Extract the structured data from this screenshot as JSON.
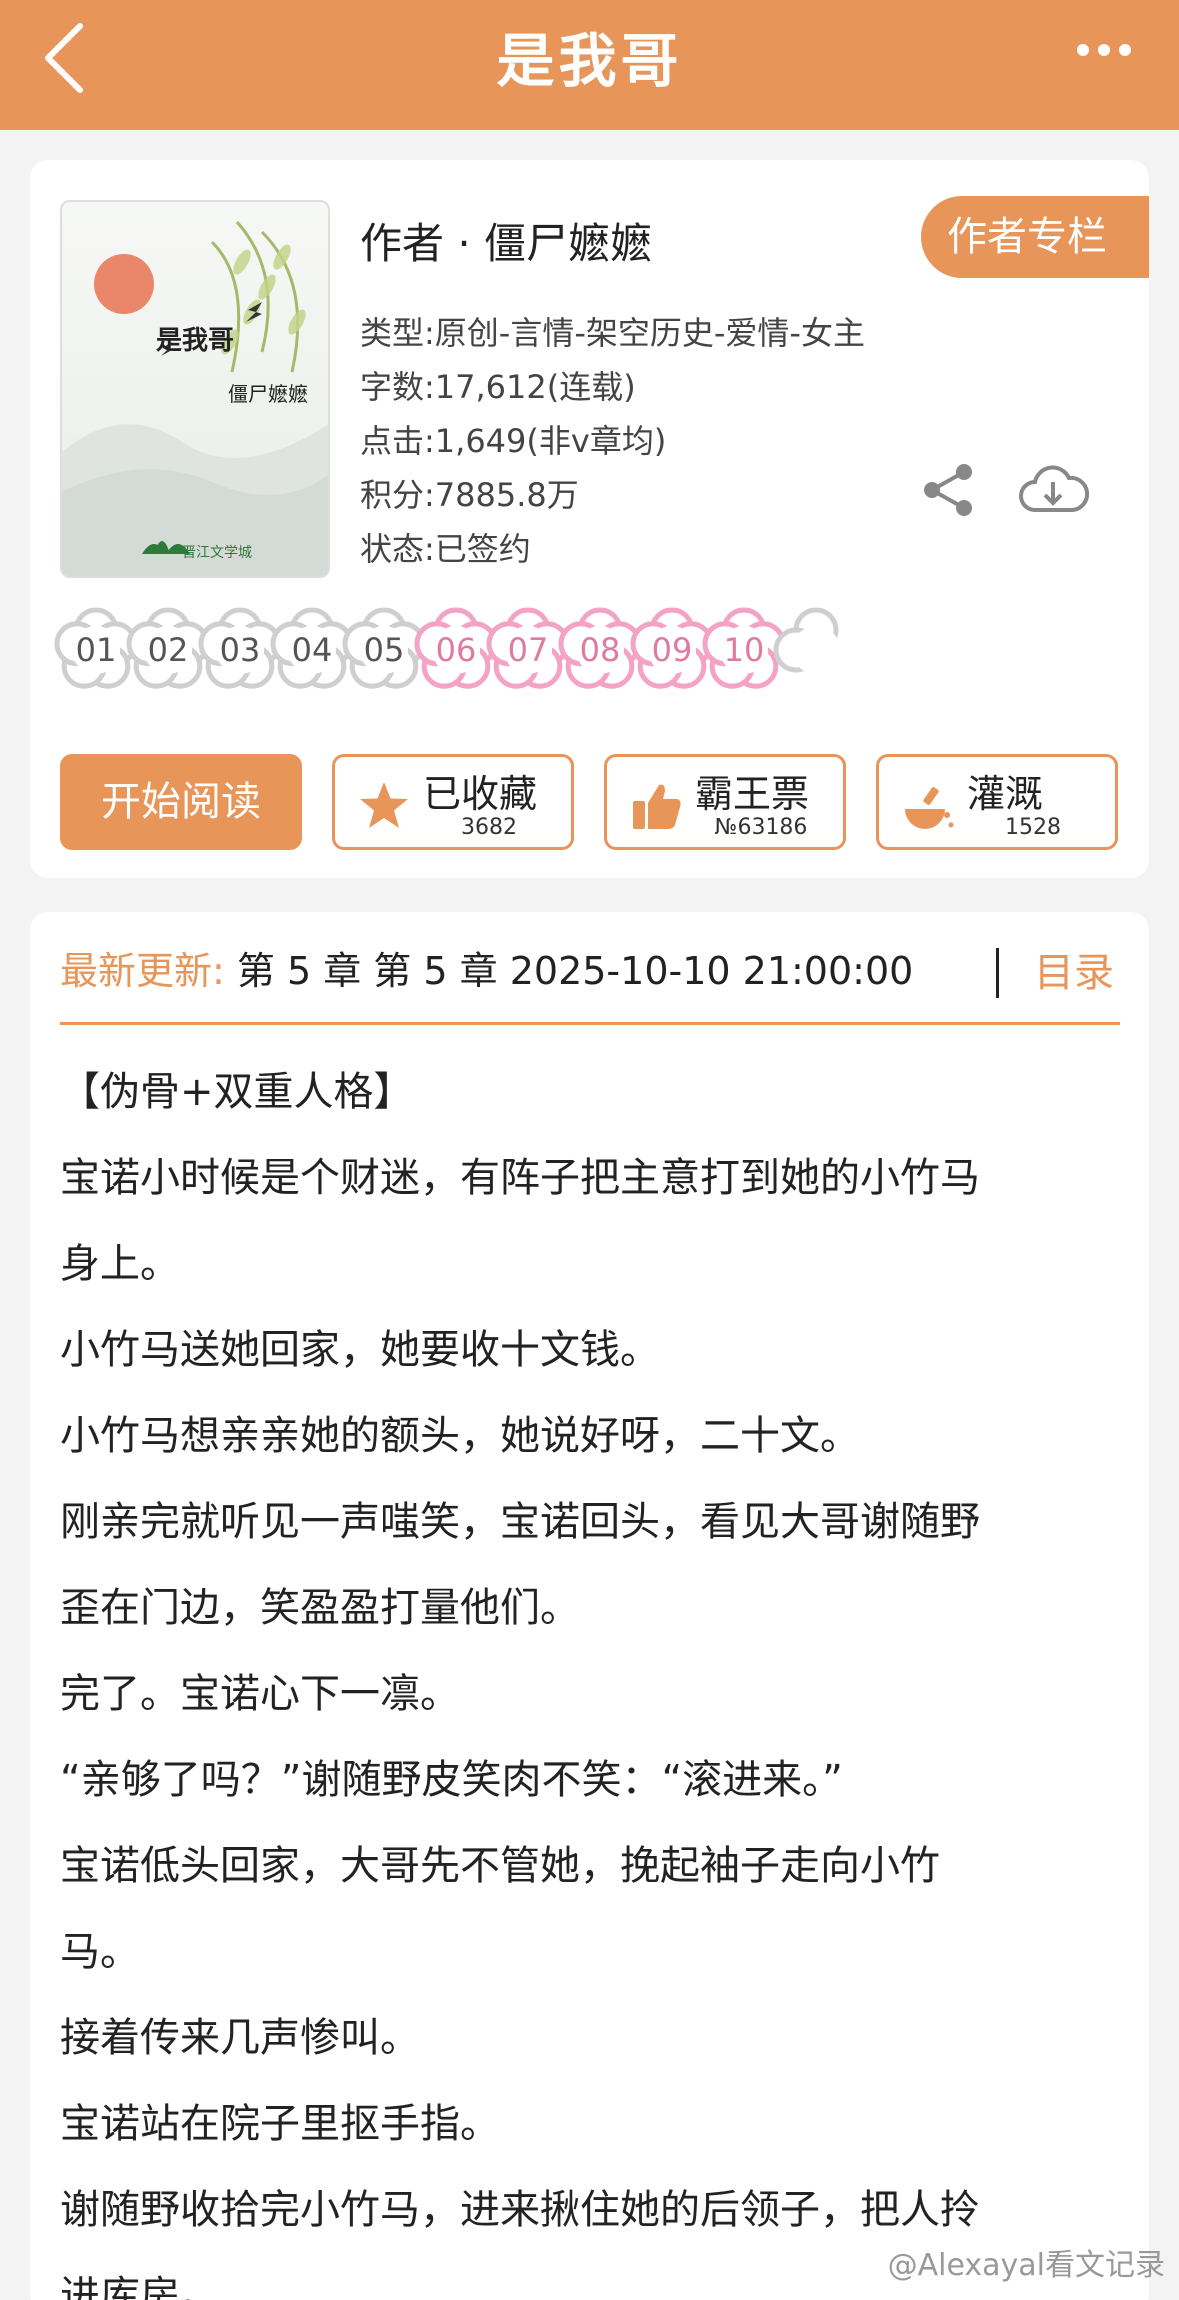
{
  "header": {
    "title": "是我哥"
  },
  "book": {
    "cover_title": "是我哥",
    "cover_author": "僵尸嬷嬷",
    "cover_logo": "晋江文学城",
    "author_line": "作者 · 僵尸嬷嬷",
    "author_column_label": "作者专栏",
    "type": "类型:原创-言情-架空历史-爱情-女主",
    "words": "字数:17,612(连载)",
    "clicks": "点击:1,649(非v章均)",
    "score": "积分:7885.8万",
    "status": "状态:已签约"
  },
  "chapters": [
    {
      "num": "01",
      "state": "grey"
    },
    {
      "num": "02",
      "state": "grey"
    },
    {
      "num": "03",
      "state": "grey"
    },
    {
      "num": "04",
      "state": "grey"
    },
    {
      "num": "05",
      "state": "grey"
    },
    {
      "num": "06",
      "state": "pink"
    },
    {
      "num": "07",
      "state": "pink"
    },
    {
      "num": "08",
      "state": "pink"
    },
    {
      "num": "09",
      "state": "pink"
    },
    {
      "num": "10",
      "state": "pink"
    }
  ],
  "actions": {
    "read_label": "开始阅读",
    "collect_label": "已收藏",
    "collect_count": "3682",
    "ticket_label": "霸王票",
    "ticket_count": "№63186",
    "water_label": "灌溉",
    "water_count": "1528"
  },
  "latest": {
    "label": "最新更新:",
    "value": " 第 5 章  第 5 章 2025-10-10 21:00:00",
    "toc_label": "目录"
  },
  "summary": [
    "【伪骨+双重人格】",
    "宝诺小时候是个财迷，有阵子把主意打到她的小竹马",
    "身上。",
    "小竹马送她回家，她要收十文钱。",
    "小竹马想亲亲她的额头，她说好呀，二十文。",
    "刚亲完就听见一声嗤笑，宝诺回头，看见大哥谢随野",
    "歪在门边，笑盈盈打量他们。",
    "完了。宝诺心下一凛。",
    "“亲够了吗？”谢随野皮笑肉不笑：“滚进来。”",
    "宝诺低头回家，大哥先不管她，挽起袖子走向小竹",
    "马。",
    "接着传来几声惨叫。",
    "宝诺站在院子里抠手指。",
    "谢随野收拾完小竹马，进来揪住她的后领子，把人拎",
    "进库房。"
  ],
  "watermark": "@Alexayal看文记录",
  "colors": {
    "accent": "#e8955a",
    "pink": "#f4a3c4",
    "grey": "#cfcfcf"
  }
}
